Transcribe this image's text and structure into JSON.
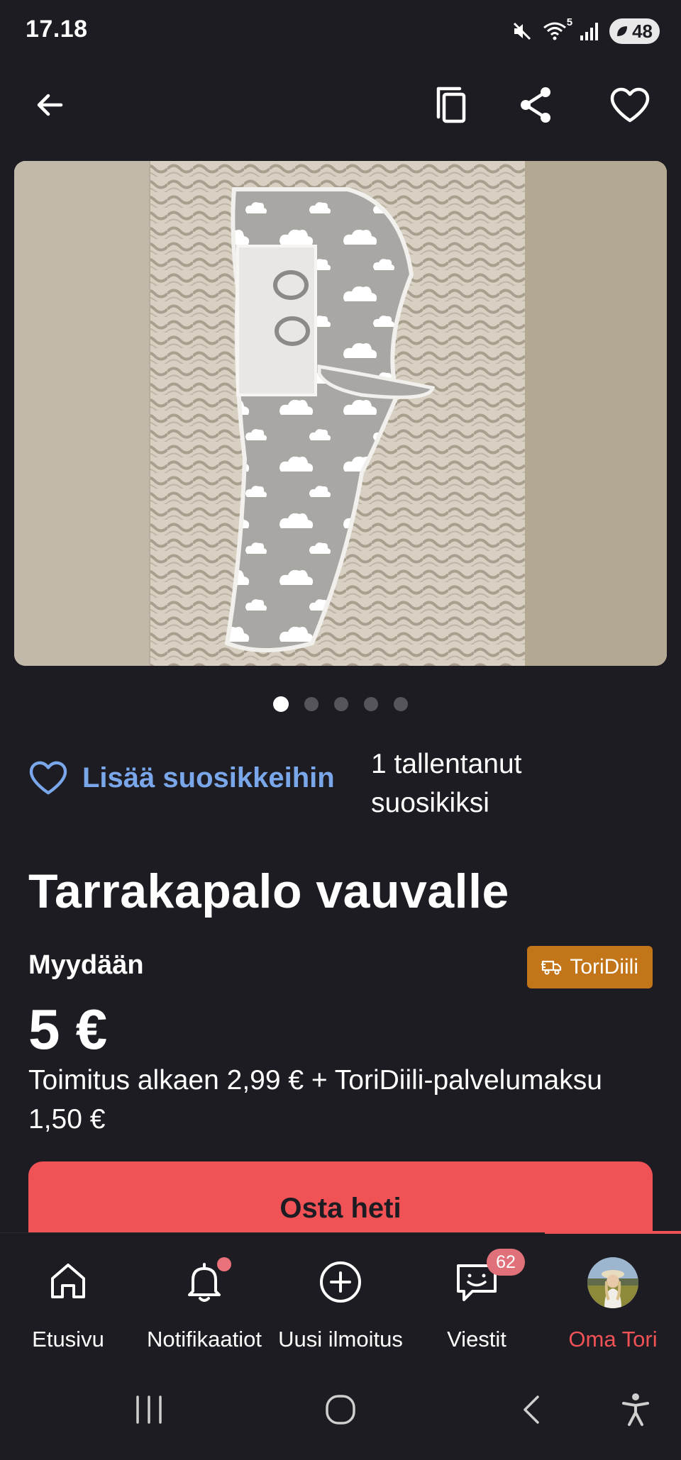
{
  "status_bar": {
    "time": "17.18",
    "wifi_label": "5",
    "battery": "48"
  },
  "icons": {
    "back": "arrow-left-icon",
    "copy": "copy-icon",
    "share": "share-icon",
    "favorite": "heart-icon"
  },
  "gallery": {
    "image_count": 5,
    "active_index": 0
  },
  "favorites": {
    "add_label": "Lisää suosikkeihin",
    "count_line1": "1 tallentanut",
    "count_line2": "suosikiksi"
  },
  "listing": {
    "title": "Tarrakapalo vauvalle",
    "sale_type": "Myydään",
    "badge": "ToriDiili",
    "price": "5 €",
    "shipping_line1": "Toimitus alkaen 2,99 € + ToriDiili-palvelumaksu",
    "shipping_line2": "1,50 €",
    "buy_button": "Osta heti"
  },
  "bottom_nav": {
    "home": "Etusivu",
    "notifications": "Notifikaatiot",
    "new_ad": "Uusi ilmoitus",
    "messages": "Viestit",
    "messages_badge": "62",
    "profile": "Oma Tori",
    "active": "profile"
  },
  "colors": {
    "background": "#1d1c22",
    "accent": "#f05256",
    "link": "#7aa7ea",
    "badge": "#c27519"
  }
}
